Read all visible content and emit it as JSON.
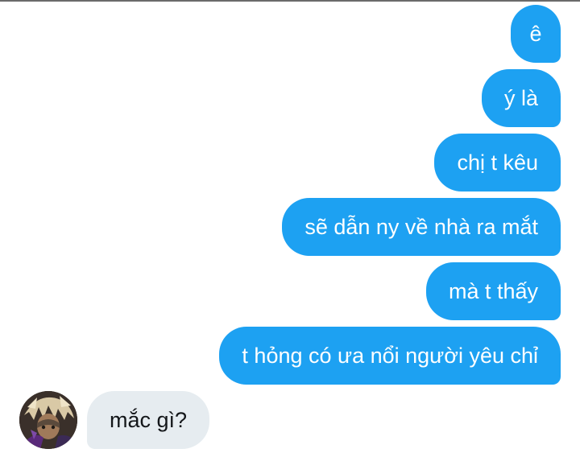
{
  "conversation": {
    "sent_messages": [
      {
        "text": "ê"
      },
      {
        "text": "ý là"
      },
      {
        "text": "chị t kêu"
      },
      {
        "text": "sẽ dẫn ny về nhà ra mắt"
      },
      {
        "text": "mà t thấy"
      },
      {
        "text": "t hỏng có ưa nổi người yêu chỉ"
      }
    ],
    "received_messages": [
      {
        "text": "mắc gì?"
      }
    ]
  },
  "colors": {
    "sent_bubble": "#1da1f2",
    "received_bubble": "#e6ecf0"
  },
  "icons": {
    "contact_avatar": "avatar"
  }
}
